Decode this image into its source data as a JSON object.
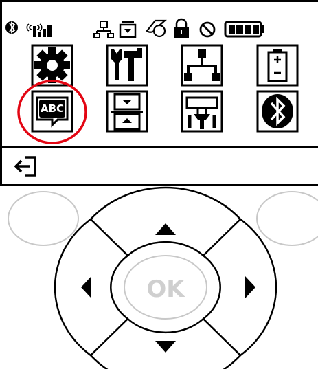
{
  "lcd": {
    "status_icons": [
      "bluetooth-icon",
      "wifi-signal-icon",
      "network-icon",
      "media-icon",
      "ribbon-icon",
      "lock-icon",
      "error-icon",
      "battery-icon"
    ],
    "menu_row_1": [
      {
        "icon": "settings-gear-icon"
      },
      {
        "icon": "tools-icon"
      },
      {
        "icon": "network-tree-icon"
      },
      {
        "icon": "battery-icon"
      }
    ],
    "menu_row_2": [
      {
        "icon": "language-abc-icon",
        "highlighted": true,
        "abc_text": "ABC"
      },
      {
        "icon": "sensors-icon"
      },
      {
        "icon": "ports-icon"
      },
      {
        "icon": "bluetooth-icon"
      }
    ],
    "footer": {
      "icon": "exit-arrow-icon"
    }
  },
  "keypad": {
    "ok_label": "OK",
    "arrow_up": "up-arrow-icon",
    "arrow_down": "down-arrow-icon",
    "arrow_left": "left-arrow-icon",
    "arrow_right": "right-arrow-icon"
  },
  "colors": {
    "lcd_foreground": "#000000",
    "highlight_ring": "#e30613",
    "key_outline": "#000000",
    "soft_key_outline": "#c8c8c8",
    "ok_text": "#cfcfcf"
  }
}
